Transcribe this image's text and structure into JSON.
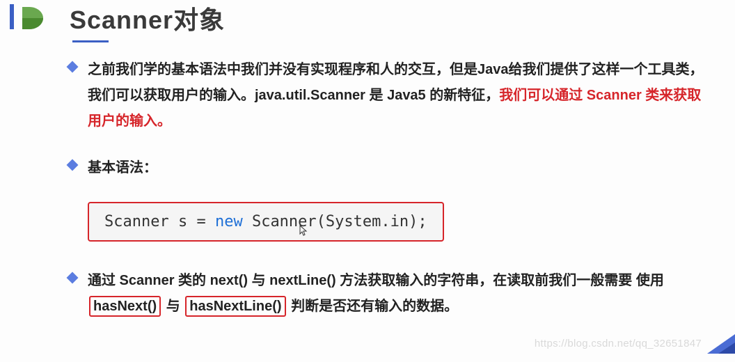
{
  "title": "Scanner对象",
  "bullets": {
    "b1_part1": "之前我们学的基本语法中我们并没有实现程序和人的交互，但是Java给我们提供了这样一个工具类，我们可以获取用户的输入。java.util.Scanner 是 Java5 的新特征，",
    "b1_red": "我们可以通过 Scanner 类来获取用户的输入。",
    "b2": "基本语法：",
    "b3_part1": "通过 Scanner 类的 next() 与 nextLine() 方法获取输入的字符串，在读取前我们一般需要 使用",
    "b3_box1": "hasNext()",
    "b3_mid": "与",
    "b3_box2": "hasNextLine()",
    "b3_part2": "判断是否还有输入的数据。"
  },
  "code": {
    "p1": "Scanner s = ",
    "kw": "new",
    "p2": " Scanner(System.in);"
  },
  "watermark": "https://blog.csdn.net/qq_32651847"
}
